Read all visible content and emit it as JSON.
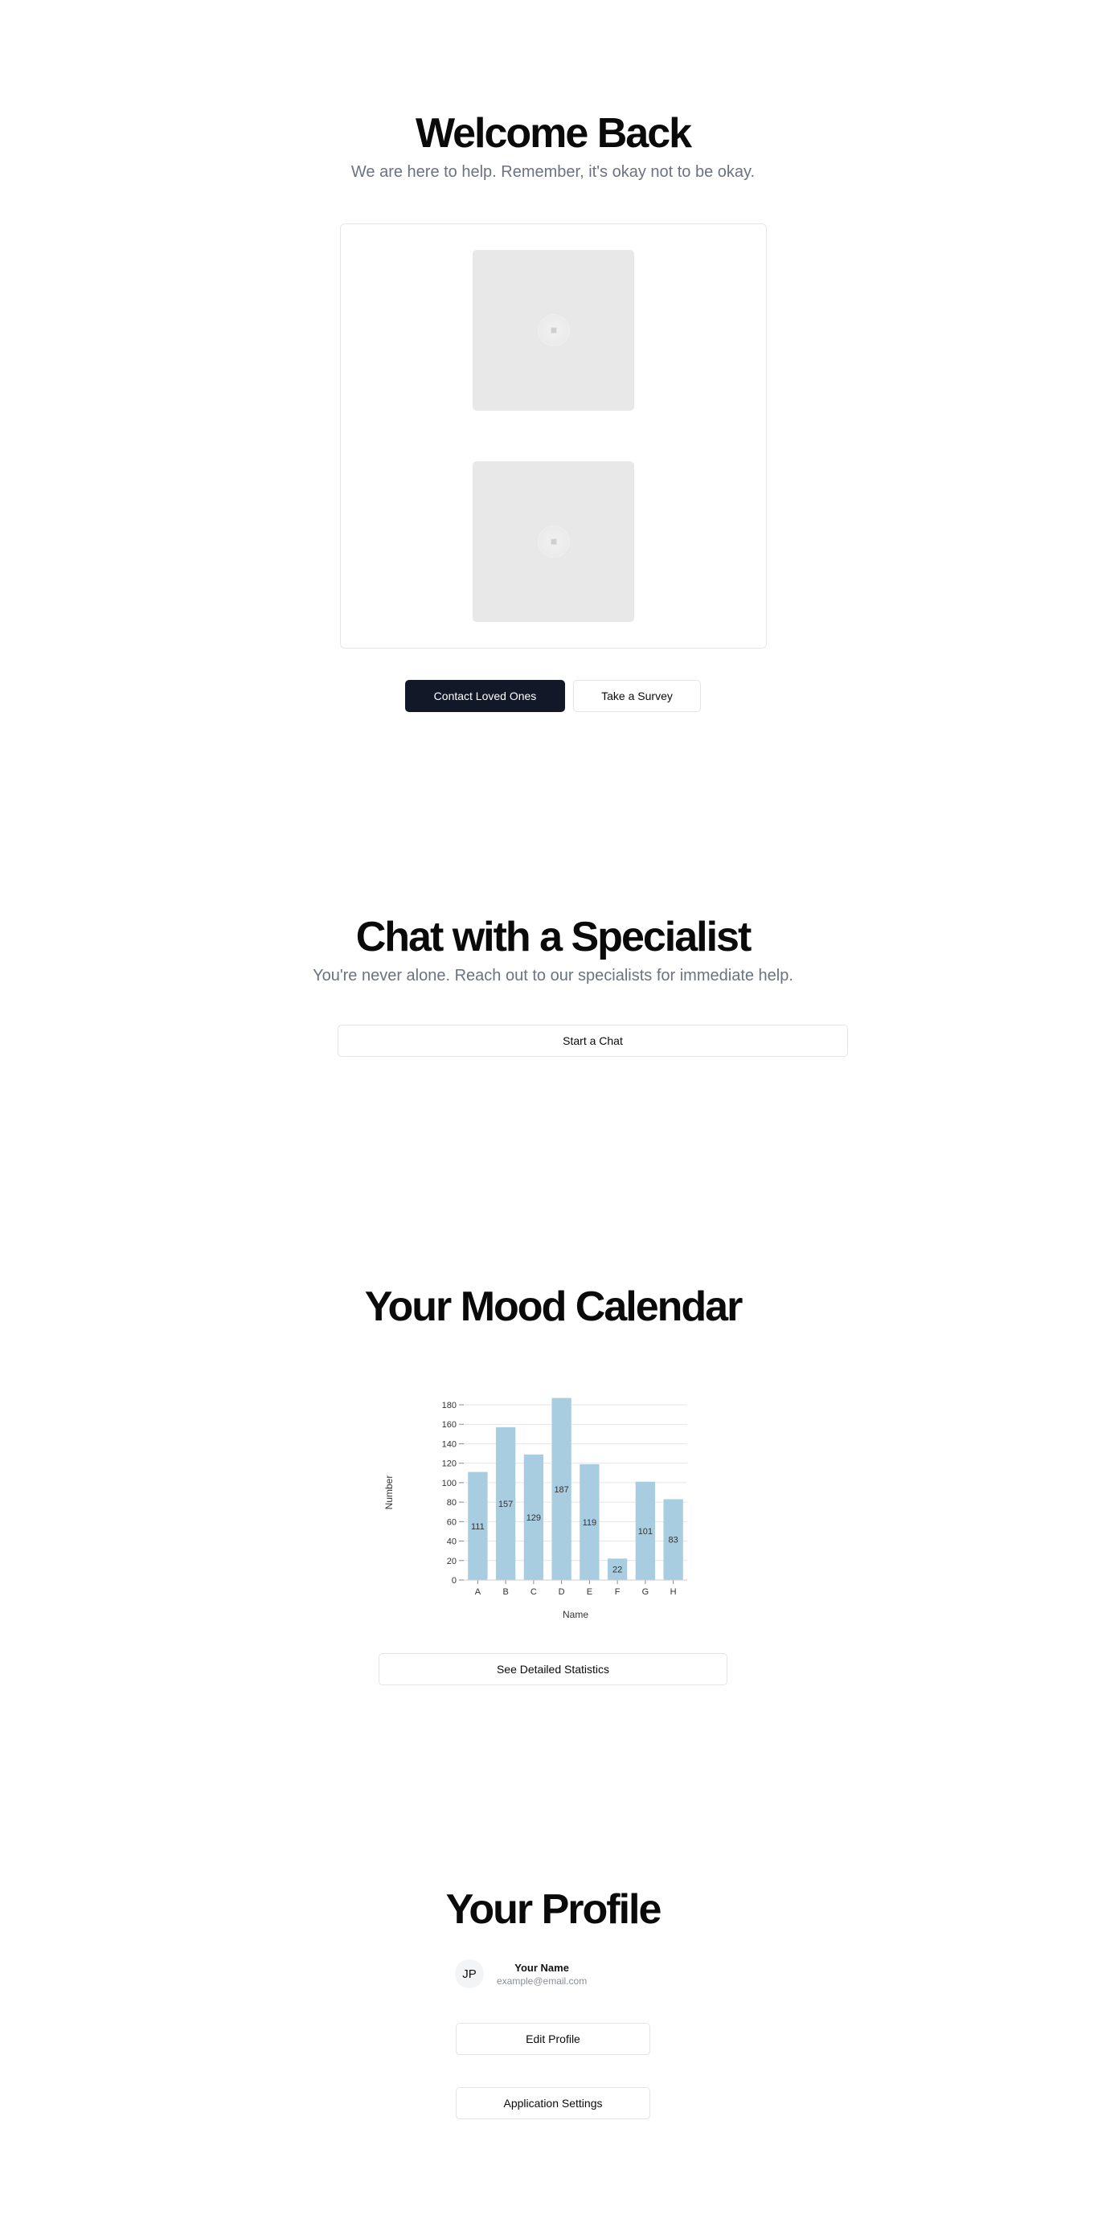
{
  "welcome": {
    "title": "Welcome Back",
    "subtitle": "We are here to help. Remember, it's okay not to be okay.",
    "contact_label": "Contact Loved Ones",
    "survey_label": "Take a Survey"
  },
  "chat": {
    "title": "Chat with a Specialist",
    "subtitle": "You're never alone. Reach out to our specialists for immediate help.",
    "start_label": "Start a Chat"
  },
  "mood": {
    "title": "Your Mood Calendar",
    "details_label": "See Detailed Statistics"
  },
  "chart_data": {
    "type": "bar",
    "categories": [
      "A",
      "B",
      "C",
      "D",
      "E",
      "F",
      "G",
      "H"
    ],
    "values": [
      111,
      157,
      129,
      187,
      119,
      22,
      101,
      83
    ],
    "xlabel": "Name",
    "ylabel": "Number",
    "ylim": [
      0,
      180
    ],
    "yticks": [
      0,
      20,
      40,
      60,
      80,
      100,
      120,
      140,
      160,
      180
    ],
    "grid": true,
    "bar_color": "#a8cde0"
  },
  "profile": {
    "title": "Your Profile",
    "initials": "JP",
    "name": "Your Name",
    "email": "example@email.com",
    "edit_label": "Edit Profile",
    "settings_label": "Application Settings"
  },
  "colors": {
    "primary_button": "#111827",
    "muted_text": "#6b7280"
  },
  "icons": [
    "image-placeholder-icon",
    "image-placeholder-icon"
  ]
}
